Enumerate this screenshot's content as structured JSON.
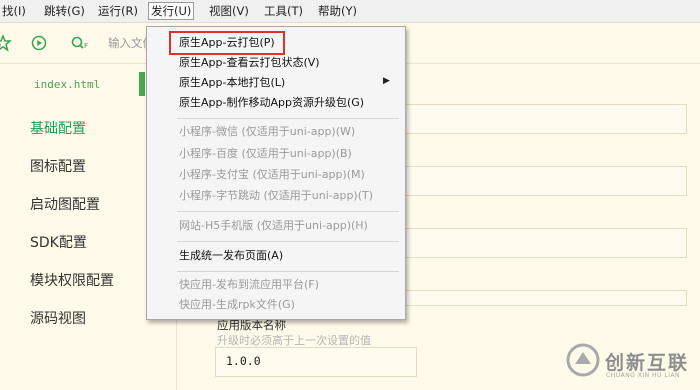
{
  "menubar": {
    "items": [
      {
        "label": "找(I)"
      },
      {
        "label": "跳转(G)"
      },
      {
        "label": "运行(R)"
      },
      {
        "label": "发行(U)"
      },
      {
        "label": "视图(V)"
      },
      {
        "label": "工具(T)"
      },
      {
        "label": "帮助(Y)"
      }
    ]
  },
  "toolbar": {
    "search_placeholder": "输入文件"
  },
  "sidebar": {
    "file_tab": "index.html",
    "items": [
      {
        "label": "基础配置"
      },
      {
        "label": "图标配置"
      },
      {
        "label": "启动图配置"
      },
      {
        "label": "SDK配置"
      },
      {
        "label": "模块权限配置"
      },
      {
        "label": "源码视图"
      }
    ]
  },
  "content": {
    "version_name_label": "应用版本名称",
    "version_name_hint": "升级时必须高于上一次设置的值",
    "version_name_value": "1.0.0"
  },
  "publish_menu": {
    "items": [
      {
        "label": "原生App-云打包(P)"
      },
      {
        "label": "原生App-查看云打包状态(V)"
      },
      {
        "label": "原生App-本地打包(L)"
      },
      {
        "label": "原生App-制作移动App资源升级包(G)"
      },
      {
        "label": "小程序-微信 (仅适用于uni-app)(W)"
      },
      {
        "label": "小程序-百度 (仅适用于uni-app)(B)"
      },
      {
        "label": "小程序-支付宝 (仅适用于uni-app)(M)"
      },
      {
        "label": "小程序-字节跳动 (仅适用于uni-app)(T)"
      },
      {
        "label": "网站-H5手机版 (仅适用于uni-app)(H)"
      },
      {
        "label": "生成统一发布页面(A)"
      },
      {
        "label": "快应用-发布到流应用平台(F)"
      },
      {
        "label": "快应用-生成rpk文件(G)"
      }
    ]
  },
  "watermark": {
    "brand": "创新互联",
    "sub": "CHUANG XIN HU LIAN"
  },
  "colors": {
    "accent_green": "#1e9c56",
    "highlight_red": "#e0302a"
  }
}
